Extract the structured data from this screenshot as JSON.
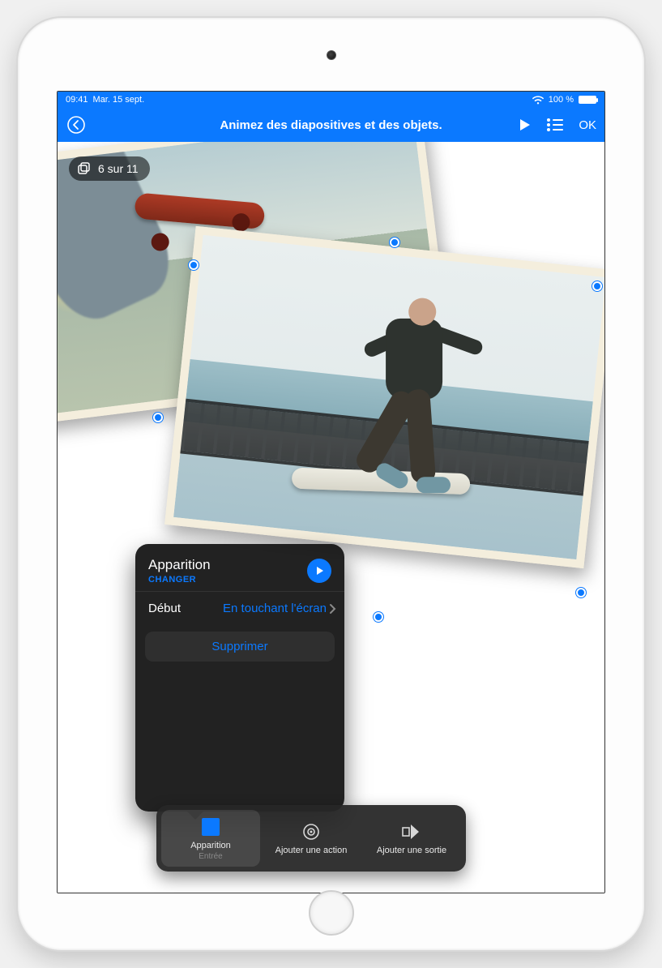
{
  "status": {
    "time": "09:41",
    "date": "Mar. 15 sept.",
    "battery_pct": "100 %",
    "wifi_icon": "wifi",
    "battery_icon": "battery-full"
  },
  "toolbar": {
    "title": "Animez des diapositives et des objets.",
    "ok_label": "OK"
  },
  "slide_counter": {
    "text": "6 sur 11"
  },
  "popover": {
    "title": "Apparition",
    "change_label": "CHANGER",
    "start_label": "Début",
    "start_value": "En touchant l'écran",
    "delete_label": "Supprimer"
  },
  "anim_bar": {
    "items": [
      {
        "label": "Apparition",
        "sub": "Entrée"
      },
      {
        "label": "Ajouter une action",
        "sub": ""
      },
      {
        "label": "Ajouter une sortie",
        "sub": ""
      }
    ]
  }
}
